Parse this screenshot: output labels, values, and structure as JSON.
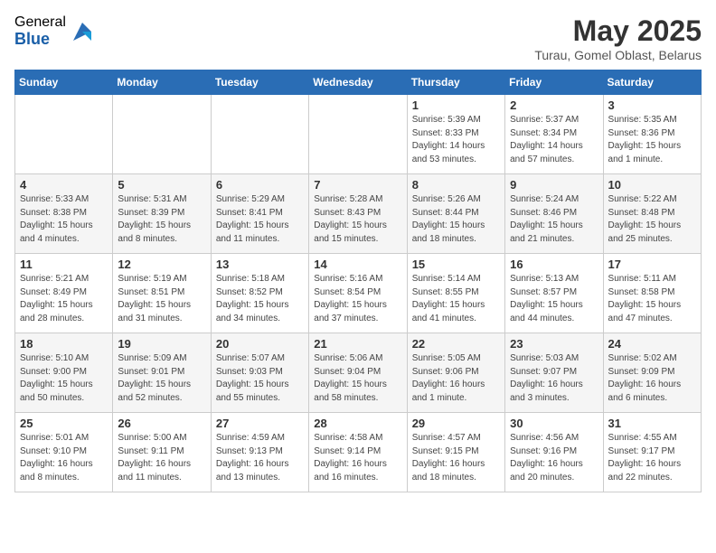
{
  "logo": {
    "general": "General",
    "blue": "Blue"
  },
  "title": "May 2025",
  "subtitle": "Turau, Gomel Oblast, Belarus",
  "days_header": [
    "Sunday",
    "Monday",
    "Tuesday",
    "Wednesday",
    "Thursday",
    "Friday",
    "Saturday"
  ],
  "weeks": [
    [
      {
        "day": "",
        "info": ""
      },
      {
        "day": "",
        "info": ""
      },
      {
        "day": "",
        "info": ""
      },
      {
        "day": "",
        "info": ""
      },
      {
        "day": "1",
        "info": "Sunrise: 5:39 AM\nSunset: 8:33 PM\nDaylight: 14 hours\nand 53 minutes."
      },
      {
        "day": "2",
        "info": "Sunrise: 5:37 AM\nSunset: 8:34 PM\nDaylight: 14 hours\nand 57 minutes."
      },
      {
        "day": "3",
        "info": "Sunrise: 5:35 AM\nSunset: 8:36 PM\nDaylight: 15 hours\nand 1 minute."
      }
    ],
    [
      {
        "day": "4",
        "info": "Sunrise: 5:33 AM\nSunset: 8:38 PM\nDaylight: 15 hours\nand 4 minutes."
      },
      {
        "day": "5",
        "info": "Sunrise: 5:31 AM\nSunset: 8:39 PM\nDaylight: 15 hours\nand 8 minutes."
      },
      {
        "day": "6",
        "info": "Sunrise: 5:29 AM\nSunset: 8:41 PM\nDaylight: 15 hours\nand 11 minutes."
      },
      {
        "day": "7",
        "info": "Sunrise: 5:28 AM\nSunset: 8:43 PM\nDaylight: 15 hours\nand 15 minutes."
      },
      {
        "day": "8",
        "info": "Sunrise: 5:26 AM\nSunset: 8:44 PM\nDaylight: 15 hours\nand 18 minutes."
      },
      {
        "day": "9",
        "info": "Sunrise: 5:24 AM\nSunset: 8:46 PM\nDaylight: 15 hours\nand 21 minutes."
      },
      {
        "day": "10",
        "info": "Sunrise: 5:22 AM\nSunset: 8:48 PM\nDaylight: 15 hours\nand 25 minutes."
      }
    ],
    [
      {
        "day": "11",
        "info": "Sunrise: 5:21 AM\nSunset: 8:49 PM\nDaylight: 15 hours\nand 28 minutes."
      },
      {
        "day": "12",
        "info": "Sunrise: 5:19 AM\nSunset: 8:51 PM\nDaylight: 15 hours\nand 31 minutes."
      },
      {
        "day": "13",
        "info": "Sunrise: 5:18 AM\nSunset: 8:52 PM\nDaylight: 15 hours\nand 34 minutes."
      },
      {
        "day": "14",
        "info": "Sunrise: 5:16 AM\nSunset: 8:54 PM\nDaylight: 15 hours\nand 37 minutes."
      },
      {
        "day": "15",
        "info": "Sunrise: 5:14 AM\nSunset: 8:55 PM\nDaylight: 15 hours\nand 41 minutes."
      },
      {
        "day": "16",
        "info": "Sunrise: 5:13 AM\nSunset: 8:57 PM\nDaylight: 15 hours\nand 44 minutes."
      },
      {
        "day": "17",
        "info": "Sunrise: 5:11 AM\nSunset: 8:58 PM\nDaylight: 15 hours\nand 47 minutes."
      }
    ],
    [
      {
        "day": "18",
        "info": "Sunrise: 5:10 AM\nSunset: 9:00 PM\nDaylight: 15 hours\nand 50 minutes."
      },
      {
        "day": "19",
        "info": "Sunrise: 5:09 AM\nSunset: 9:01 PM\nDaylight: 15 hours\nand 52 minutes."
      },
      {
        "day": "20",
        "info": "Sunrise: 5:07 AM\nSunset: 9:03 PM\nDaylight: 15 hours\nand 55 minutes."
      },
      {
        "day": "21",
        "info": "Sunrise: 5:06 AM\nSunset: 9:04 PM\nDaylight: 15 hours\nand 58 minutes."
      },
      {
        "day": "22",
        "info": "Sunrise: 5:05 AM\nSunset: 9:06 PM\nDaylight: 16 hours\nand 1 minute."
      },
      {
        "day": "23",
        "info": "Sunrise: 5:03 AM\nSunset: 9:07 PM\nDaylight: 16 hours\nand 3 minutes."
      },
      {
        "day": "24",
        "info": "Sunrise: 5:02 AM\nSunset: 9:09 PM\nDaylight: 16 hours\nand 6 minutes."
      }
    ],
    [
      {
        "day": "25",
        "info": "Sunrise: 5:01 AM\nSunset: 9:10 PM\nDaylight: 16 hours\nand 8 minutes."
      },
      {
        "day": "26",
        "info": "Sunrise: 5:00 AM\nSunset: 9:11 PM\nDaylight: 16 hours\nand 11 minutes."
      },
      {
        "day": "27",
        "info": "Sunrise: 4:59 AM\nSunset: 9:13 PM\nDaylight: 16 hours\nand 13 minutes."
      },
      {
        "day": "28",
        "info": "Sunrise: 4:58 AM\nSunset: 9:14 PM\nDaylight: 16 hours\nand 16 minutes."
      },
      {
        "day": "29",
        "info": "Sunrise: 4:57 AM\nSunset: 9:15 PM\nDaylight: 16 hours\nand 18 minutes."
      },
      {
        "day": "30",
        "info": "Sunrise: 4:56 AM\nSunset: 9:16 PM\nDaylight: 16 hours\nand 20 minutes."
      },
      {
        "day": "31",
        "info": "Sunrise: 4:55 AM\nSunset: 9:17 PM\nDaylight: 16 hours\nand 22 minutes."
      }
    ]
  ]
}
